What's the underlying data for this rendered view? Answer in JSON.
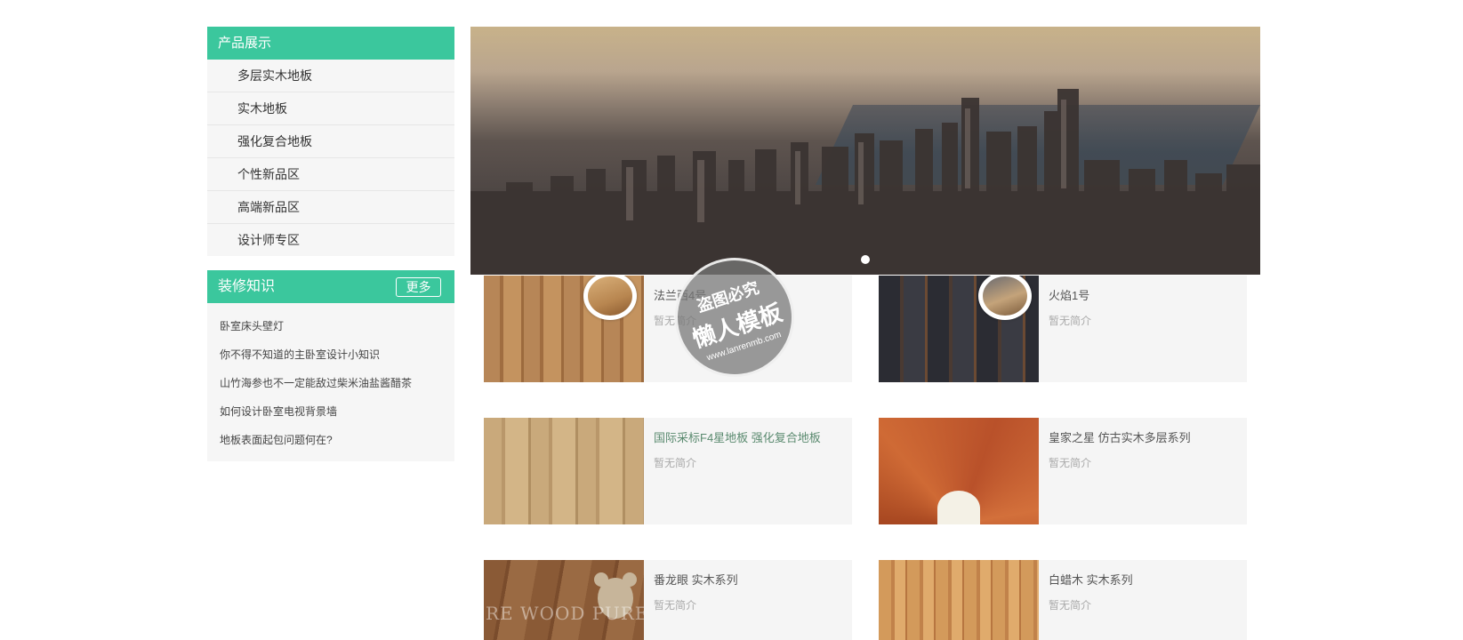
{
  "categories": {
    "title": "产品展示",
    "items": [
      {
        "label": "多层实木地板"
      },
      {
        "label": "实木地板"
      },
      {
        "label": "强化复合地板"
      },
      {
        "label": "个性新品区"
      },
      {
        "label": "高端新品区"
      },
      {
        "label": "设计师专区"
      }
    ]
  },
  "news": {
    "title": "装修知识",
    "more_label": "更多",
    "items": [
      {
        "label": "卧室床头壁灯"
      },
      {
        "label": "你不得不知道的主卧室设计小知识"
      },
      {
        "label": "山竹海参也不一定能敌过柴米油盐酱醋茶"
      },
      {
        "label": "如何设计卧室电视背景墙"
      },
      {
        "label": "地板表面起包问题何在?"
      }
    ]
  },
  "banner": {
    "active_slide": 1,
    "slide_count": 1
  },
  "products": [
    {
      "title": "法兰西4号",
      "desc": "暂无简介"
    },
    {
      "title": "火焰1号",
      "desc": "暂无简介"
    },
    {
      "title": "国际采标F4星地板 强化复合地板",
      "desc": "暂无简介"
    },
    {
      "title": "皇家之星 仿古实木多层系列",
      "desc": "暂无简介"
    },
    {
      "title": "番龙眼 实木系列",
      "desc": "暂无简介"
    },
    {
      "title": "白蜡木 实木系列",
      "desc": "暂无简介"
    }
  ],
  "photo_text": {
    "wood5_caption": "RE WOOD PURE"
  },
  "watermark": {
    "line1": "盗图必究",
    "line2": "懒人模板",
    "line3": "www.lanrenmb.com"
  },
  "colors": {
    "accent": "#3bc79d",
    "panel_bg": "#f6f6f6",
    "card_bg": "#f5f5f5"
  }
}
